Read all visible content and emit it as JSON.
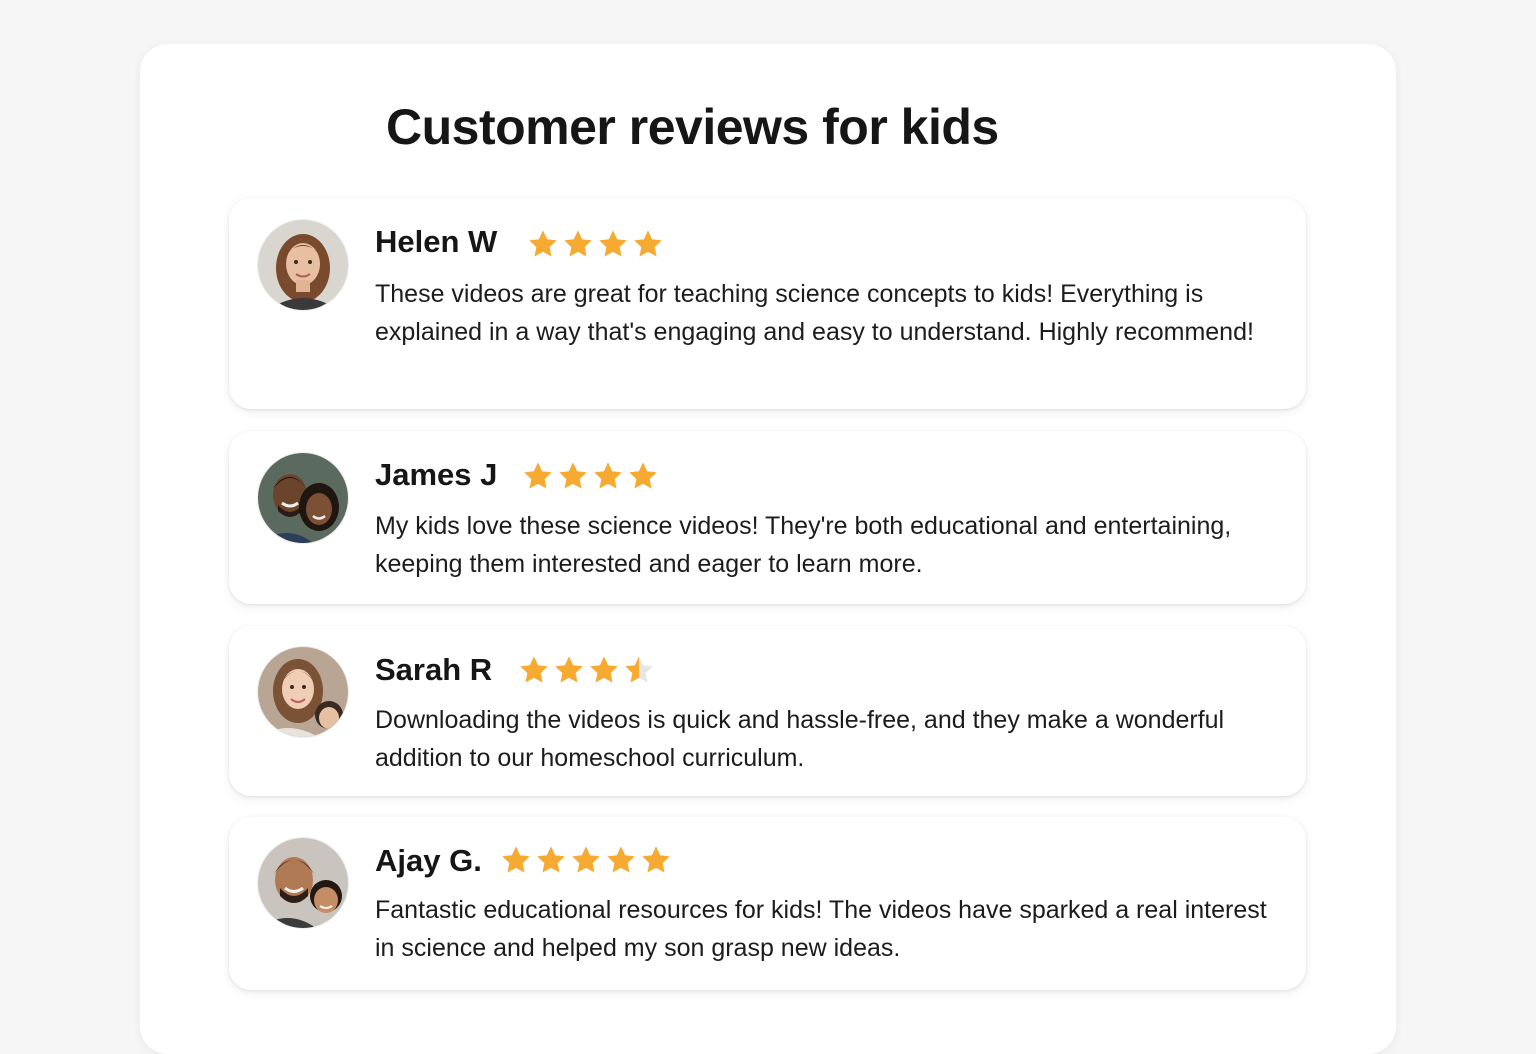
{
  "page": {
    "title": "Customer reviews for kids"
  },
  "colors": {
    "star_fill": "#F6AA32",
    "star_empty": "#E6E6E6",
    "card_bg": "#FFFFFF",
    "page_bg": "#F6F6F6"
  },
  "reviews": [
    {
      "name": "Helen W",
      "rating": 4,
      "rating_max": 4,
      "avatar": "woman-portrait-avatar",
      "text": "These videos are great for teaching science concepts to kids! Everything is explained in a way that's engaging and easy to understand. Highly recommend!"
    },
    {
      "name": "James J",
      "rating": 4,
      "rating_max": 4,
      "avatar": "father-daughter-avatar",
      "text": "My kids love these science  videos! They're both educational and entertaining, keeping them interested and eager to learn more."
    },
    {
      "name": "Sarah R",
      "rating": 3.5,
      "rating_max": 4,
      "avatar": "mother-child-avatar",
      "text": "Downloading the videos is quick and hassle-free, and they make a wonderful addition to our homeschool curriculum."
    },
    {
      "name": "Ajay G.",
      "rating": 5,
      "rating_max": 5,
      "avatar": "father-son-avatar",
      "text": "Fantastic educational resources for kids! The videos have sparked a real interest in science and helped my son grasp new ideas."
    }
  ]
}
